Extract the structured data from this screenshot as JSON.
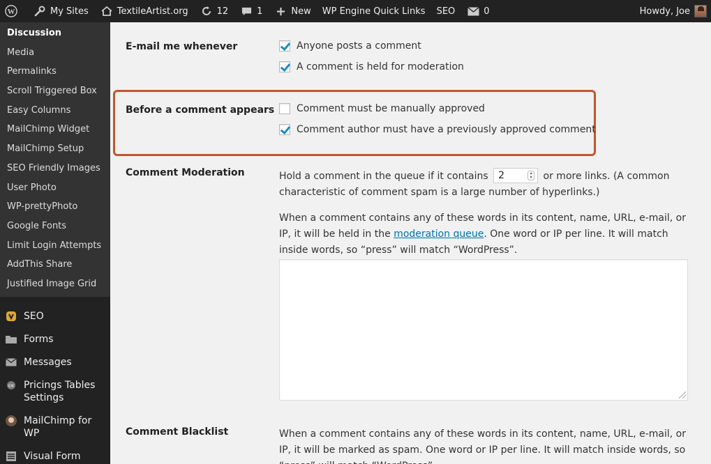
{
  "adminbar": {
    "my_sites": "My Sites",
    "site_name": "TextileArtist.org",
    "updates_count": "12",
    "comments_count": "1",
    "new_label": "New",
    "wpengine_label": "WP Engine Quick Links",
    "seo_label": "SEO",
    "messages_count": "0",
    "howdy": "Howdy, Joe"
  },
  "sidebar": {
    "submenu": [
      "Discussion",
      "Media",
      "Permalinks",
      "Scroll Triggered Box",
      "Easy Columns",
      "MailChimp Widget",
      "MailChimp Setup",
      "SEO Friendly Images",
      "User Photo",
      "WP-prettyPhoto",
      "Google Fonts",
      "Limit Login Attempts",
      "AddThis Share",
      "Justified Image Grid"
    ],
    "menu": [
      {
        "label": "SEO",
        "icon": "seo-icon"
      },
      {
        "label": "Forms",
        "icon": "folder-icon"
      },
      {
        "label": "Messages",
        "icon": "envelope-icon"
      },
      {
        "label": "Pricings Tables Settings",
        "icon": "pricing-icon"
      },
      {
        "label": "MailChimp for WP",
        "icon": "mailchimp-icon"
      },
      {
        "label": "Visual Form Builder",
        "icon": "form-builder-icon"
      }
    ]
  },
  "main": {
    "email_label": "E-mail me whenever",
    "email_opt1": "Anyone posts a comment",
    "email_opt2": "A comment is held for moderation",
    "before_label": "Before a comment appears",
    "before_opt1": "Comment must be manually approved",
    "before_opt2": "Comment author must have a previously approved comment",
    "moderation_label": "Comment Moderation",
    "moderation_text_before": "Hold a comment in the queue if it contains",
    "moderation_links_value": "2",
    "moderation_text_after": "or more links. (A common characteristic of comment spam is a large number of hyperlinks.)",
    "moderation_para_before": "When a comment contains any of these words in its content, name, URL, e-mail, or IP, it will be held in the",
    "moderation_queue_link": "moderation queue",
    "moderation_para_after": ". One word or IP per line. It will match inside words, so “press” will match “WordPress”.",
    "moderation_keys_value": "",
    "blacklist_label": "Comment Blacklist",
    "blacklist_para": "When a comment contains any of these words in its content, name, URL, e-mail, or IP, it will be marked as spam. One word or IP per line. It will match inside words, so “press” will match “WordPress”."
  },
  "checkboxes": {
    "email_opt1": true,
    "email_opt2": true,
    "before_opt1": false,
    "before_opt2": true
  },
  "colors": {
    "highlight": "#c0572d",
    "checkmark": "#1e8cbe",
    "link": "#0073aa"
  }
}
